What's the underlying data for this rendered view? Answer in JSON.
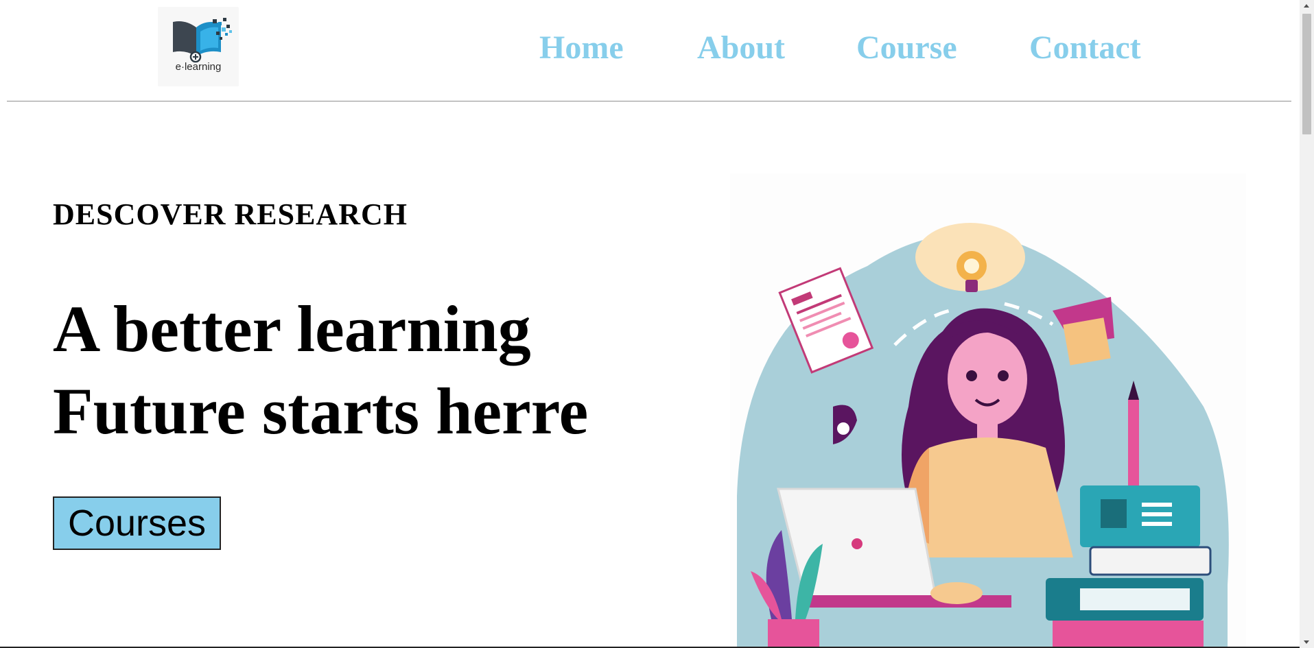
{
  "header": {
    "logo_text": "e·learning",
    "logo_icon": "open-book-pixel-icon",
    "nav": [
      {
        "label": "Home"
      },
      {
        "label": "About"
      },
      {
        "label": "Course"
      },
      {
        "label": "Contact"
      }
    ]
  },
  "hero": {
    "eyebrow": "DESCOVER RESEARCH",
    "headline_line1": "A better learning",
    "headline_line2": "Future starts herre",
    "cta_label": "Courses",
    "illustration": "girl-studying-with-laptop-illustration"
  },
  "colors": {
    "nav_link": "#87ceeb",
    "cta_background": "#87ceeb",
    "text": "#000000"
  }
}
